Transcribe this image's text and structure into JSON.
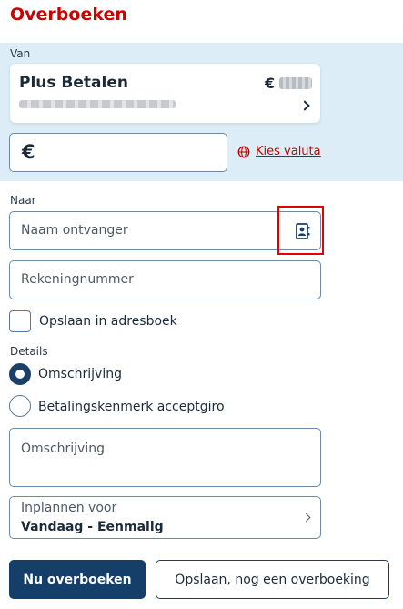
{
  "page": {
    "title": "Overboeken"
  },
  "from": {
    "label": "Van",
    "account": {
      "name": "Plus Betalen",
      "currency_symbol": "€"
    },
    "amount": {
      "currency_symbol": "€",
      "value": ""
    },
    "currency_link": "Kies valuta"
  },
  "to": {
    "label": "Naar",
    "recipient_placeholder": "Naam ontvanger",
    "account_number_placeholder": "Rekeningnummer",
    "save_to_addressbook": "Opslaan in adresboek"
  },
  "details": {
    "label": "Details",
    "options": [
      {
        "label": "Omschrijving",
        "selected": true
      },
      {
        "label": "Betalingskenmerk acceptgiro",
        "selected": false
      }
    ],
    "description_placeholder": "Omschrijving"
  },
  "schedule": {
    "label": "Inplannen voor",
    "value": "Vandaag - Eenmalig"
  },
  "actions": {
    "submit": "Nu overboeken",
    "save_another": "Opslaan, nog een overboeking"
  },
  "colors": {
    "brand_red": "#cc0000",
    "primary_blue": "#153f69",
    "section_bg": "#dcedf8",
    "highlight_red": "#e30000"
  }
}
